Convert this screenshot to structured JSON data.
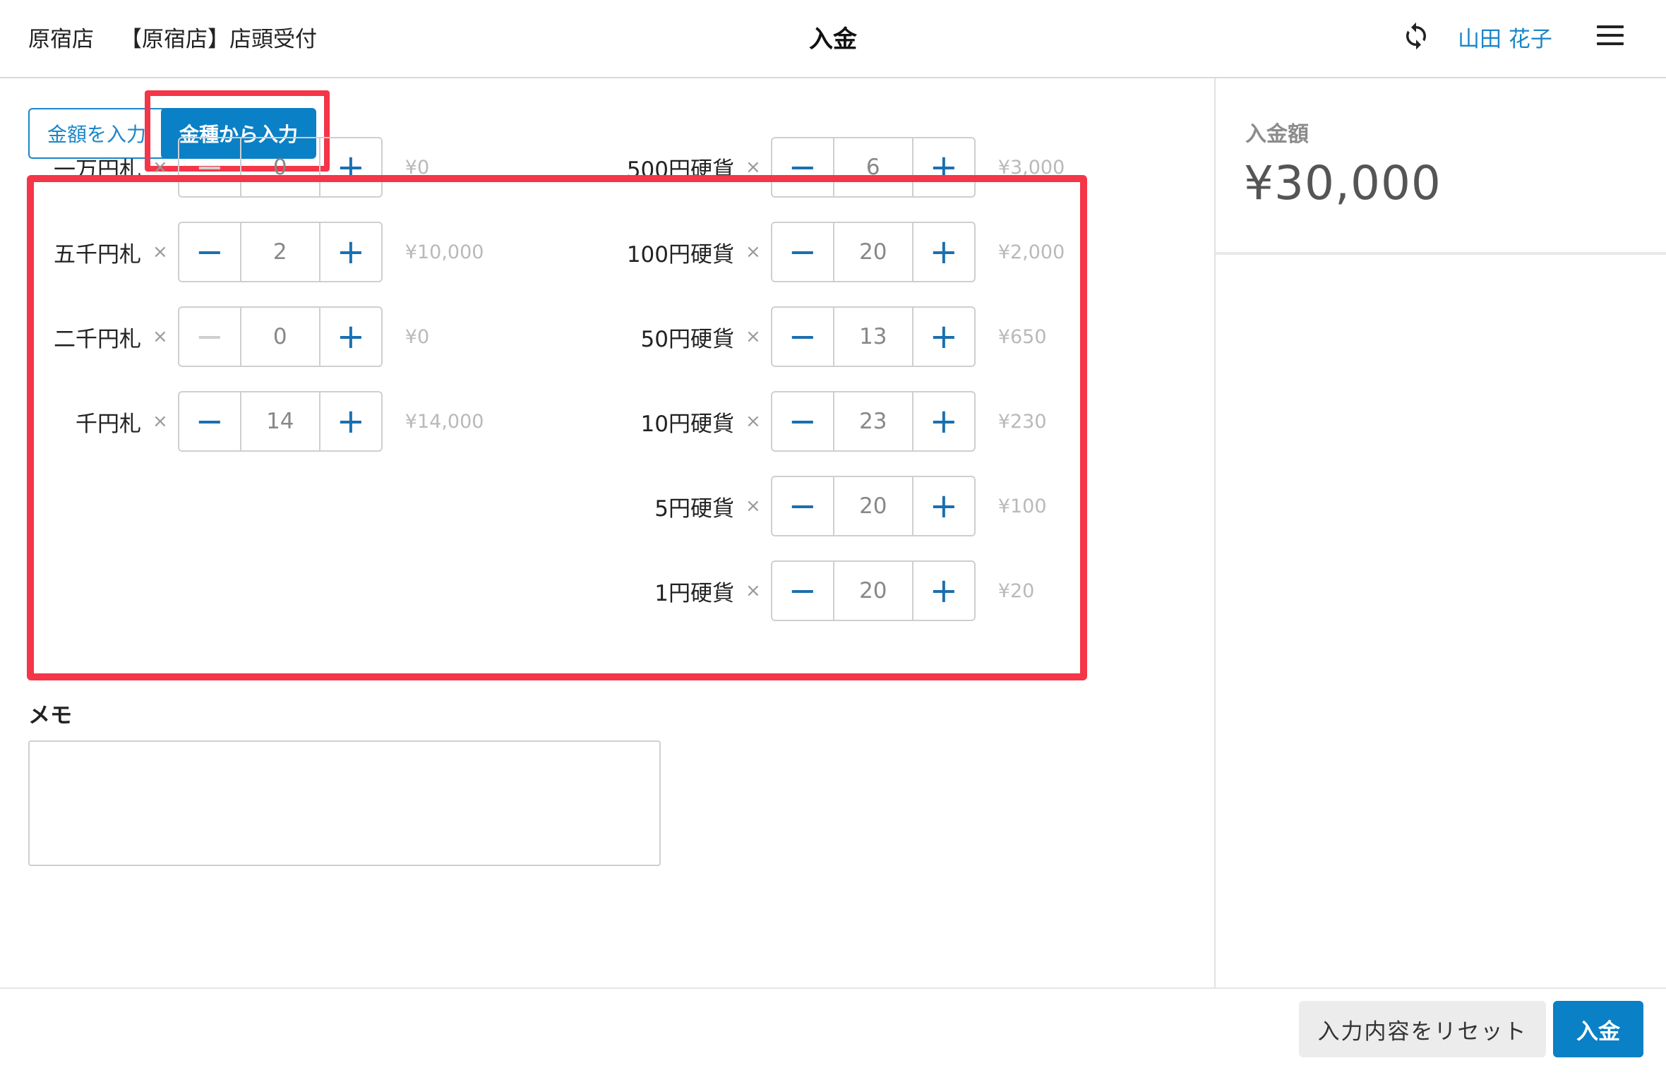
{
  "header": {
    "store": "原宿店",
    "register": "【原宿店】店頭受付",
    "title": "入金",
    "user": "山田 花子"
  },
  "icons": {
    "refresh": "refresh-icon",
    "menu": "hamburger-menu-icon"
  },
  "mode": {
    "amount_label": "金額を入力",
    "denomination_label": "金種から入力",
    "selected": "denomination"
  },
  "times_symbol": "×",
  "bills": [
    {
      "label": "一万円札",
      "count": "0",
      "subtotal": "¥0",
      "minus_disabled": true
    },
    {
      "label": "五千円札",
      "count": "2",
      "subtotal": "¥10,000",
      "minus_disabled": false
    },
    {
      "label": "二千円札",
      "count": "0",
      "subtotal": "¥0",
      "minus_disabled": true
    },
    {
      "label": "千円札",
      "count": "14",
      "subtotal": "¥14,000",
      "minus_disabled": false
    }
  ],
  "coins": [
    {
      "label": "500円硬貨",
      "count": "6",
      "subtotal": "¥3,000",
      "minus_disabled": false
    },
    {
      "label": "100円硬貨",
      "count": "20",
      "subtotal": "¥2,000",
      "minus_disabled": false
    },
    {
      "label": "50円硬貨",
      "count": "13",
      "subtotal": "¥650",
      "minus_disabled": false
    },
    {
      "label": "10円硬貨",
      "count": "23",
      "subtotal": "¥230",
      "minus_disabled": false
    },
    {
      "label": "5円硬貨",
      "count": "20",
      "subtotal": "¥100",
      "minus_disabled": false
    },
    {
      "label": "1円硬貨",
      "count": "20",
      "subtotal": "¥20",
      "minus_disabled": false
    }
  ],
  "stepper": {
    "minus": "−",
    "plus": "+"
  },
  "memo": {
    "label": "メモ",
    "value": ""
  },
  "summary": {
    "label": "入金額",
    "amount": "¥30,000"
  },
  "footer": {
    "reset_label": "入力内容をリセット",
    "submit_label": "入金"
  },
  "colors": {
    "accent": "#0a80c6",
    "highlight": "#f53548"
  }
}
